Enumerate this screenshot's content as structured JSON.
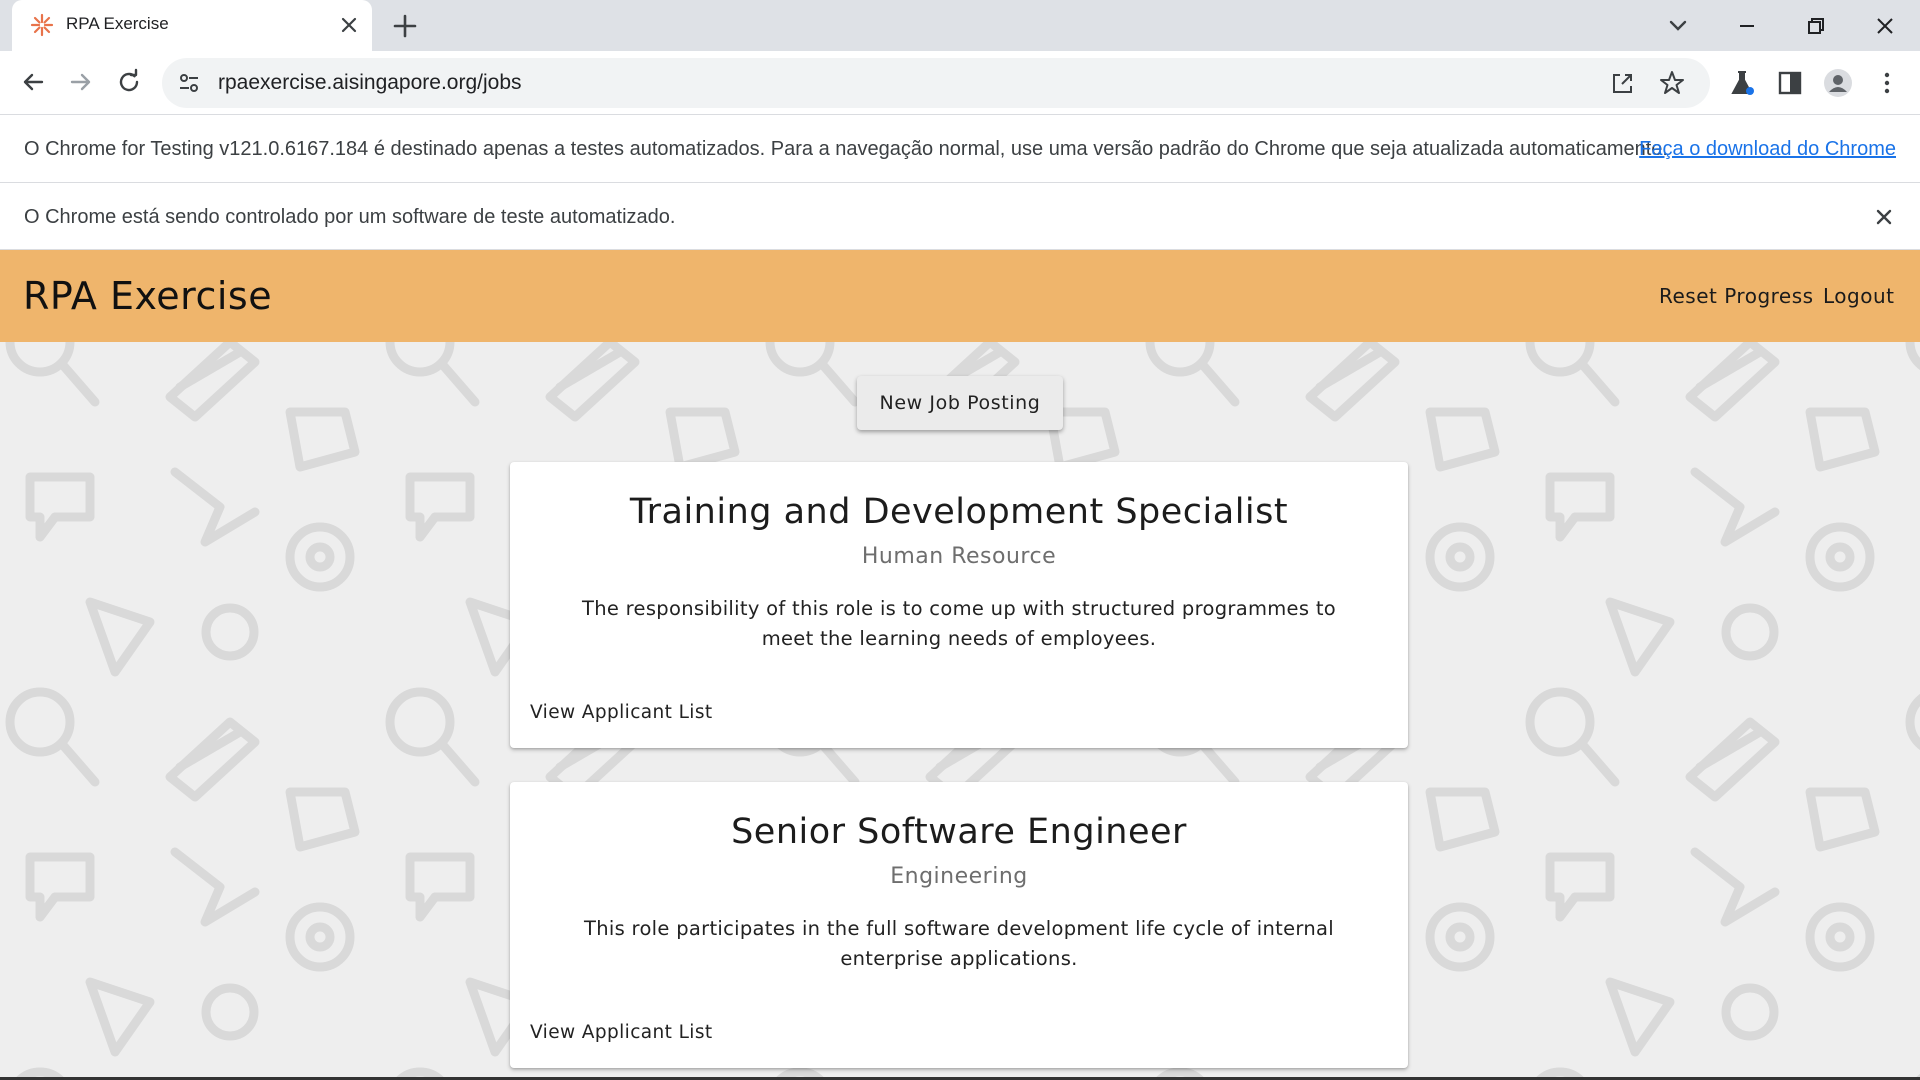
{
  "browser": {
    "tab_title": "RPA Exercise",
    "url": "rpaexercise.aisingapore.org/jobs"
  },
  "infobar_testing": {
    "message": "O Chrome for Testing v121.0.6167.184 é destinado apenas a testes automatizados. Para a navegação normal, use uma versão padrão do Chrome que seja atualizada automaticamente.",
    "link": "Faça o download do Chrome"
  },
  "infobar_automation": {
    "message": "O Chrome está sendo controlado por um software de teste automatizado."
  },
  "app": {
    "brand": "RPA Exercise",
    "nav": {
      "reset": "Reset Progress",
      "logout": "Logout"
    },
    "new_job_button": "New Job Posting",
    "accent_color": "#efb56c"
  },
  "jobs": [
    {
      "title": "Training and Development Specialist",
      "department": "Human Resource",
      "description": "The responsibility of this role is to come up with structured programmes to meet the learning needs of employees.",
      "link": "View Applicant List"
    },
    {
      "title": "Senior Software Engineer",
      "department": "Engineering",
      "description": "This role participates in the full software development life cycle of internal enterprise applications.",
      "link": "View Applicant List"
    }
  ]
}
